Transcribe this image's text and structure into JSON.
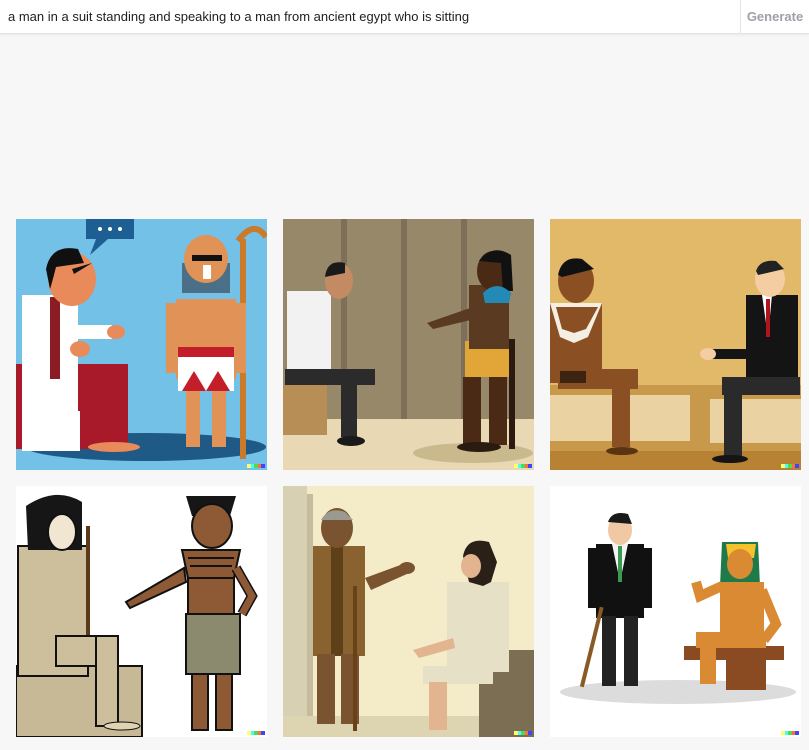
{
  "prompt": {
    "value": "a man in a suit standing and speaking to a man from ancient egypt who is sitting"
  },
  "generate_button": {
    "label": "Generate"
  },
  "colors": {
    "disabled_text": "#a0a0a8",
    "page_background": "#f7f7f8",
    "signature": [
      "#ffff66",
      "#42ffff",
      "#51da4c",
      "#ff6e3c",
      "#3c46ff"
    ]
  },
  "results": {
    "count": 6
  }
}
